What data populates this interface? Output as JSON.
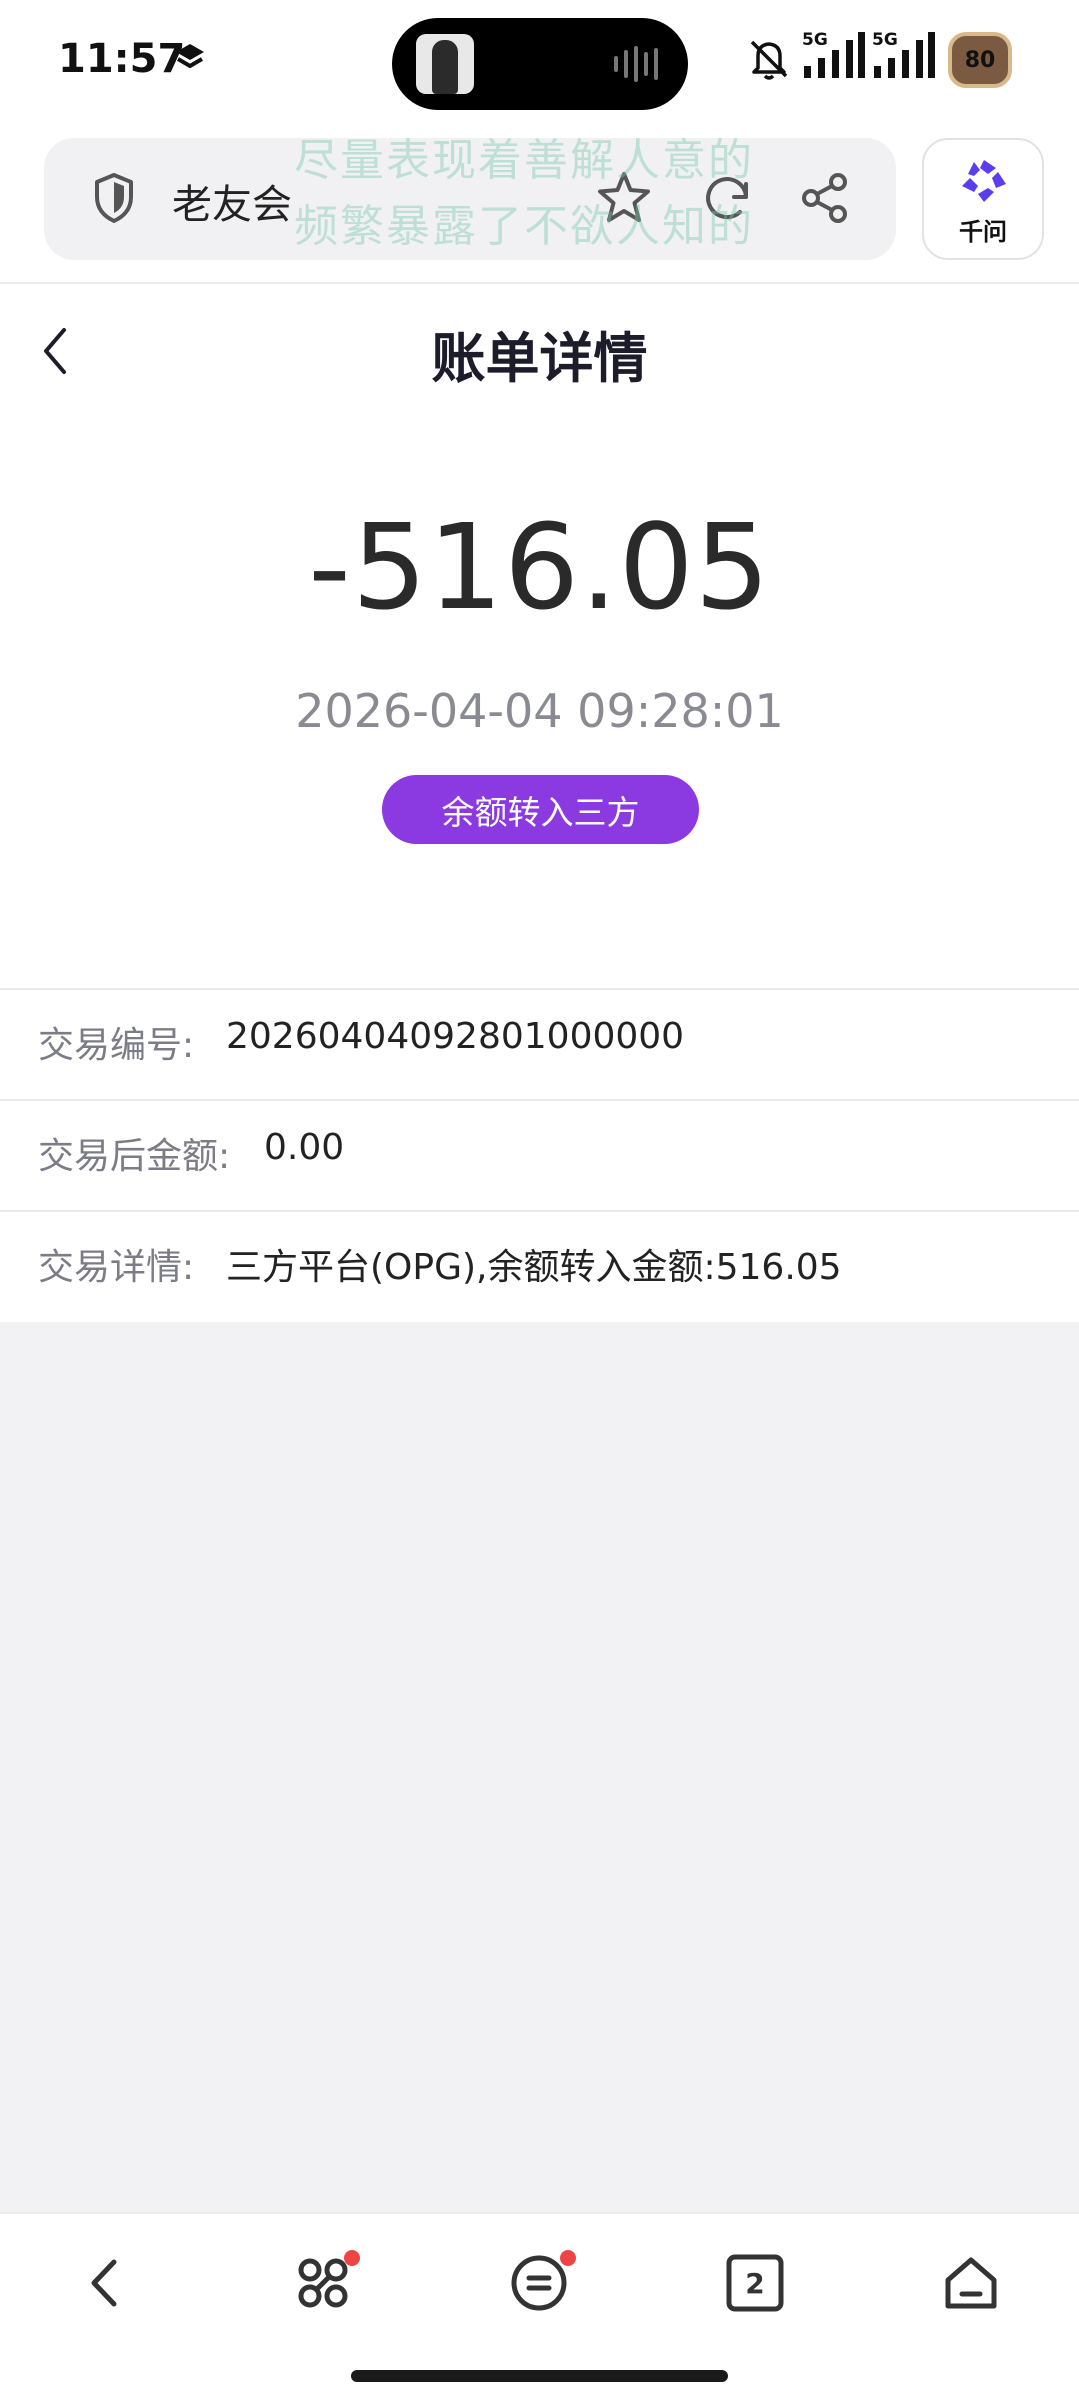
{
  "status_bar": {
    "time": "11:57",
    "signal_1_label": "5G",
    "signal_2_label": "5G",
    "battery": "80"
  },
  "browser": {
    "site_name": "老友会",
    "overlay_line_1": "尽量表现着善解人意的",
    "overlay_line_2": "频繁暴露了不欲人知的",
    "assistant_label": "千问"
  },
  "page": {
    "title": "账单详情",
    "amount": "-516.05",
    "timestamp": "2026-04-04 09:28:01",
    "type_badge": "余额转入三方"
  },
  "details": [
    {
      "label": "交易编号:",
      "value": "20260404092801000000"
    },
    {
      "label": "交易后金额:",
      "value": "0.00"
    },
    {
      "label": "交易详情:",
      "value": "三方平台(OPG),余额转入金额:516.05"
    }
  ],
  "bottom_nav": {
    "tab_count": "2"
  },
  "colors": {
    "accent": "#8a3ae0",
    "assistant_logo": "#5b3df0",
    "badge_dot": "#ef4444"
  }
}
